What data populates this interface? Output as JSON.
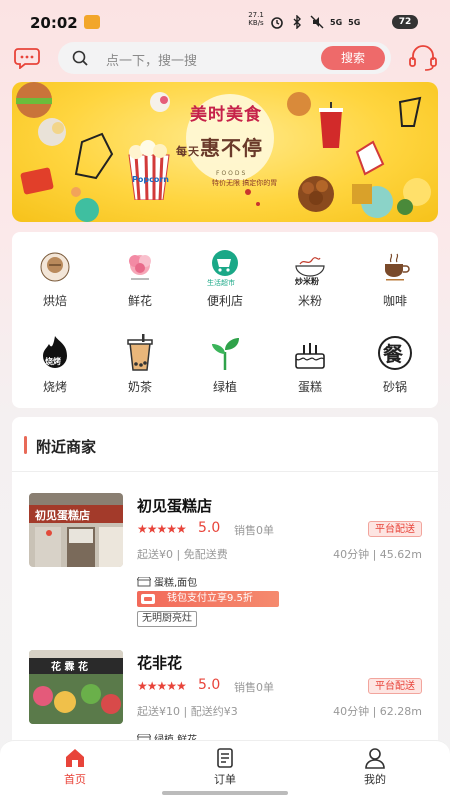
{
  "status_bar": {
    "time": "20:02",
    "net_speed_value": "27.1",
    "net_speed_unit": "KB/s",
    "signal_1": "5G",
    "signal_2": "5G",
    "battery": "72"
  },
  "header": {
    "search_placeholder": "点一下，搜一搜",
    "search_button": "搜索"
  },
  "banner": {
    "line1": "美时美食",
    "line2_small": "每天",
    "line2": "惠不停",
    "foods": "FOODS",
    "sub": "特价无限 搞定你的胃",
    "cup_text": "Popcorn"
  },
  "categories": [
    {
      "label": "烘焙",
      "icon": "bakery-icon"
    },
    {
      "label": "鲜花",
      "icon": "flower-icon"
    },
    {
      "label": "便利店",
      "icon": "convenience-store-icon"
    },
    {
      "label": "米粉",
      "icon": "rice-noodle-icon"
    },
    {
      "label": "咖啡",
      "icon": "coffee-icon"
    },
    {
      "label": "烧烤",
      "icon": "bbq-icon"
    },
    {
      "label": "奶茶",
      "icon": "milk-tea-icon"
    },
    {
      "label": "绿植",
      "icon": "plant-icon"
    },
    {
      "label": "蛋糕",
      "icon": "cake-icon"
    },
    {
      "label": "砂锅",
      "icon": "clay-pot-icon"
    }
  ],
  "category_icon_text": {
    "convenience": "生活超市",
    "noodle": "炒米粉",
    "bbq": "烧烤",
    "claypot": "餐"
  },
  "nearby": {
    "title": "附近商家",
    "stores": [
      {
        "name": "初见蛋糕店",
        "stars": "★★★★★",
        "rating": "5.0",
        "sales": "销售0单",
        "delivery_tag": "平台配送",
        "meta": "起送¥0 | 免配送费",
        "distance": "40分钟 | 45.62m",
        "categories": "蛋糕,面包",
        "promo": "钱包支付立享9.5折",
        "badge": "无明厨亮灶",
        "sign_text": "初见蛋糕店"
      },
      {
        "name": "花非花",
        "stars": "★★★★★",
        "rating": "5.0",
        "sales": "销售0单",
        "delivery_tag": "平台配送",
        "meta": "起送¥10 | 配送约¥3",
        "distance": "40分钟 | 62.28m",
        "categories": "绿植,鲜花",
        "sign_text": "花 霖 花"
      }
    ]
  },
  "bottom_nav": [
    {
      "label": "首页",
      "icon": "home-icon",
      "active": true
    },
    {
      "label": "订单",
      "icon": "order-icon",
      "active": false
    },
    {
      "label": "我的",
      "icon": "profile-icon",
      "active": false
    }
  ],
  "colors": {
    "accent": "#e8443a",
    "search_button": "#ee6a6a",
    "banner_yellow": "#ffd53f",
    "promo_red": "#f26a5a"
  }
}
